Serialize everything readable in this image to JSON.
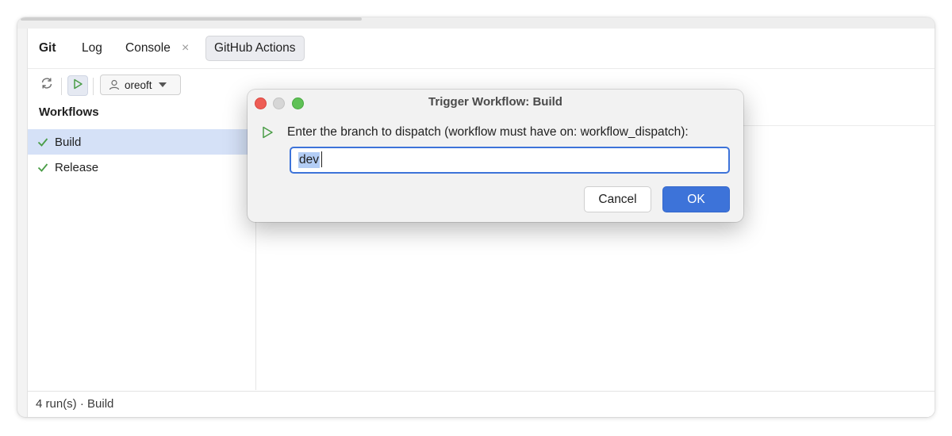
{
  "tabs": {
    "git": "Git",
    "log": "Log",
    "console": "Console",
    "close_glyph": "×",
    "github_actions": "GitHub Actions"
  },
  "toolbar": {
    "user_label": "oreoft"
  },
  "sidebar": {
    "title": "Workflows",
    "items": [
      {
        "label": "Build",
        "status": "success",
        "selected": true
      },
      {
        "label": "Release",
        "status": "success",
        "selected": false
      }
    ]
  },
  "status_bar": {
    "text": "4 run(s) · Build"
  },
  "dialog": {
    "title": "Trigger Workflow: Build",
    "message": "Enter the branch to dispatch (workflow must have on: workflow_dispatch):",
    "branch_value": "dev",
    "cancel_label": "Cancel",
    "ok_label": "OK"
  },
  "colors": {
    "accent": "#3d73d9",
    "success": "#4a9d47",
    "selection": "#d5e1f7"
  },
  "icons": {
    "refresh": "refresh-icon",
    "run": "run-icon",
    "user": "user-icon",
    "check": "check-icon"
  }
}
